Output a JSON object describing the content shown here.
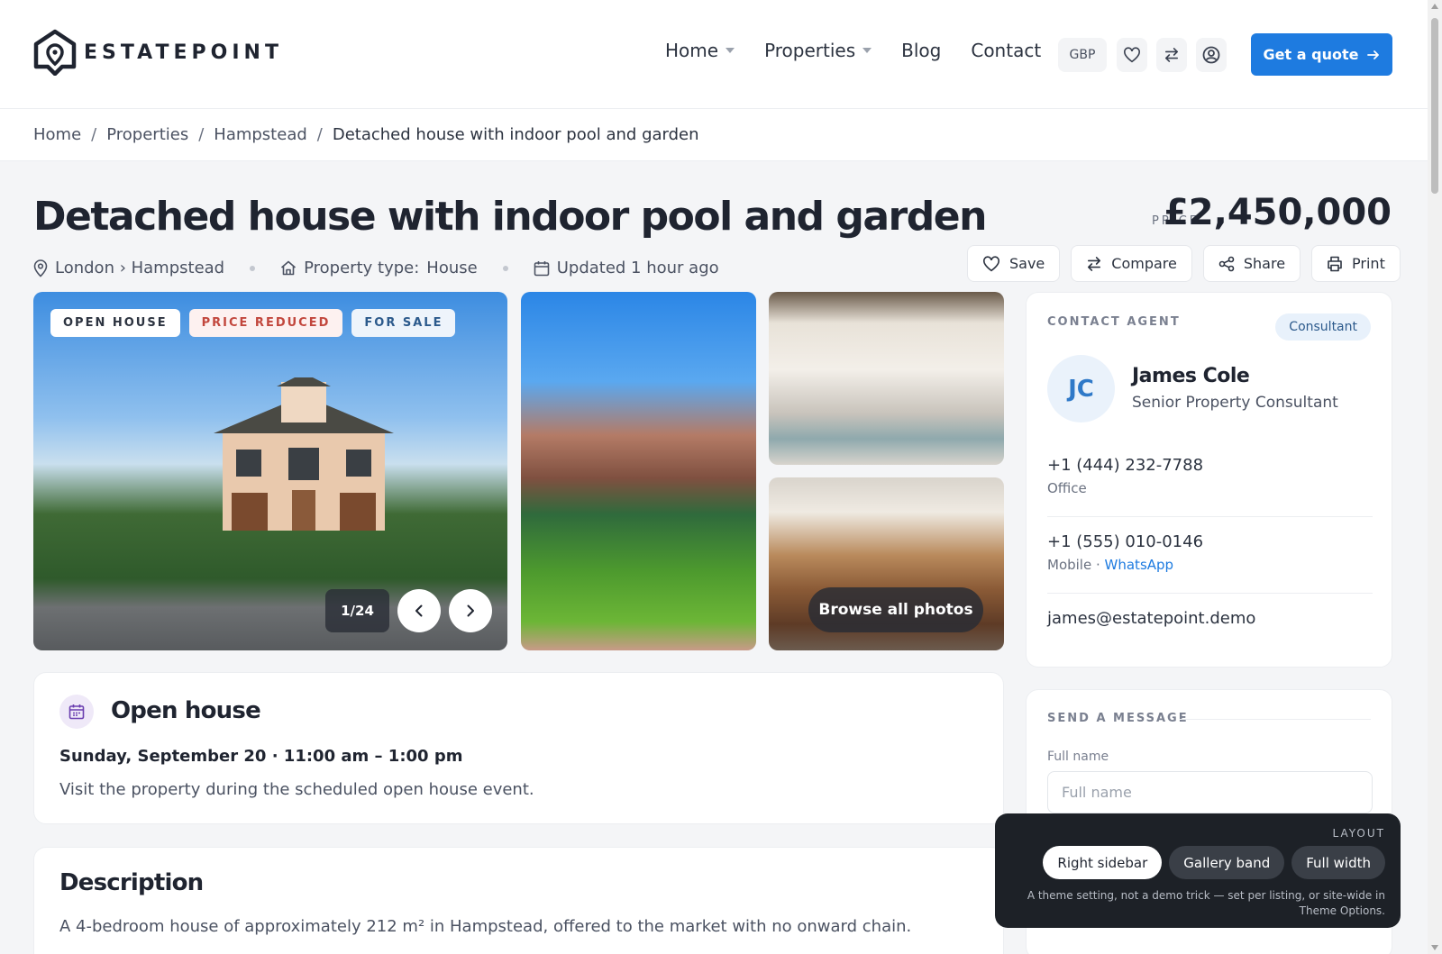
{
  "brand": {
    "name": "ESTATEPOINT"
  },
  "nav": {
    "items": [
      {
        "label": "Home",
        "dropdown": true
      },
      {
        "label": "Properties",
        "dropdown": true
      },
      {
        "label": "Blog",
        "dropdown": false
      },
      {
        "label": "Contact",
        "dropdown": false
      }
    ],
    "currency": "GBP",
    "quote_label": "Get a quote"
  },
  "breadcrumb": [
    "Home",
    "Properties",
    "Hampstead",
    "Detached house with indoor pool and garden"
  ],
  "listing": {
    "title": "Detached house with indoor pool and garden",
    "price_label": "PRICE",
    "price": "£2,450,000",
    "location": "London › Hampstead",
    "type_label": "Property type:",
    "type_value": "House",
    "updated": "Updated 1 hour ago"
  },
  "actions": {
    "save": "Save",
    "compare": "Compare",
    "share": "Share",
    "print": "Print"
  },
  "gallery": {
    "badges": {
      "open": "OPEN HOUSE",
      "reduced": "PRICE REDUCED",
      "sale": "FOR SALE"
    },
    "counter": "1/24",
    "browse": "Browse all photos"
  },
  "agent": {
    "heading": "CONTACT AGENT",
    "chip": "Consultant",
    "initials": "JC",
    "name": "James Cole",
    "role": "Senior Property Consultant",
    "office_phone": "+1 (444) 232-7788",
    "office_label": "Office",
    "mobile_phone": "+1 (555) 010-0146",
    "mobile_label": "Mobile ·",
    "whatsapp": "WhatsApp",
    "email": "james@estatepoint.demo"
  },
  "message": {
    "heading": "SEND A MESSAGE",
    "name_label": "Full name",
    "name_placeholder": "Full name"
  },
  "open_house": {
    "title": "Open house",
    "when": "Sunday, September 20 · 11:00 am – 1:00 pm",
    "desc": "Visit the property during the scheduled open house event."
  },
  "description": {
    "title": "Description",
    "text": "A 4-bedroom house of approximately 212 m² in Hampstead, offered to the market with no onward chain."
  },
  "layout_switcher": {
    "label": "LAYOUT",
    "options": [
      "Right sidebar",
      "Gallery band",
      "Full width"
    ],
    "active": "Right sidebar",
    "note": "A theme setting, not a demo trick — set per listing, or site-wide in Theme Options."
  },
  "colors": {
    "accent": "#1e7be0",
    "dark": "#1d2127",
    "reduced": "#c2473d"
  }
}
